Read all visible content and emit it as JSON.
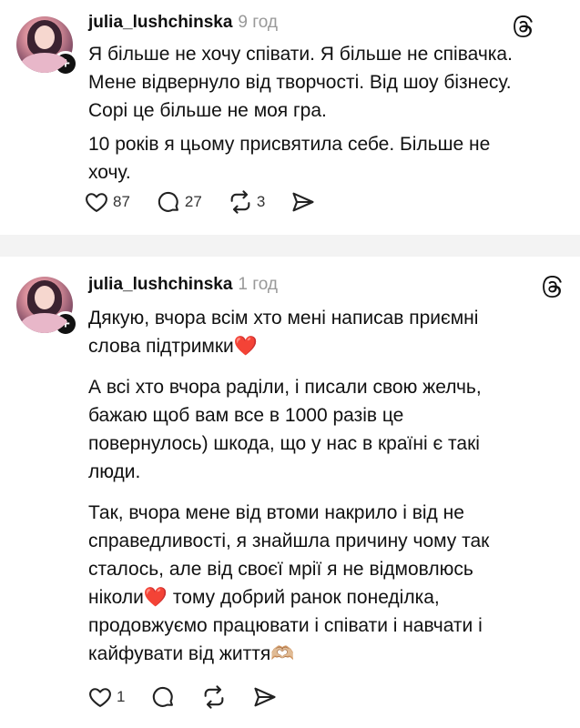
{
  "posts": [
    {
      "username": "julia_lushchinska",
      "time": "9 год",
      "lines": [
        "Я більше не хочу співати. Я більше не співачка.",
        "Мене відвернуло від творчості. Від шоу бізнесу.",
        "Сорі це більше не моя гра."
      ],
      "lines2": [
        "10 років я цьому присвятила себе. Більше не",
        "хочу."
      ],
      "likes": "87",
      "comments": "27",
      "reposts": "3"
    },
    {
      "username": "julia_lushchinska",
      "time": "1 год",
      "p1": [
        "Дякую, вчора всім хто мені написав приємні",
        "слова підтримки"
      ],
      "p1_emoji": "❤️",
      "p2": [
        "А всі хто вчора раділи, і писали свою желчь,",
        "бажаю щоб вам все в 1000 разів це",
        "повернулось) шкода, що у нас в країні є такі",
        "люди."
      ],
      "p3_a": [
        "Так, вчора мене від втоми накрило і від не",
        "справедливості, я знайшла причину чому так",
        "сталось, але від своєї мрії я не відмовлюсь"
      ],
      "p3_b_start": "ніколи",
      "p3_b_emoji": "❤️",
      "p3_b_end": " тому добрий ранок понеділка,",
      "p3_c": [
        "продовжуємо працювати і співати і навчати і"
      ],
      "p3_d": "кайфувати від життя",
      "p3_d_emoji": "🫶🏼",
      "likes": "1"
    }
  ],
  "icons": {
    "like": "heart-outline-icon",
    "comment": "comment-bubble-icon",
    "repost": "repost-arrows-icon",
    "share": "send-paper-plane-icon",
    "app": "threads-logo-icon",
    "follow": "plus-icon"
  },
  "colors": {
    "emoji_heart": "#e0142b",
    "time": "#999999"
  }
}
